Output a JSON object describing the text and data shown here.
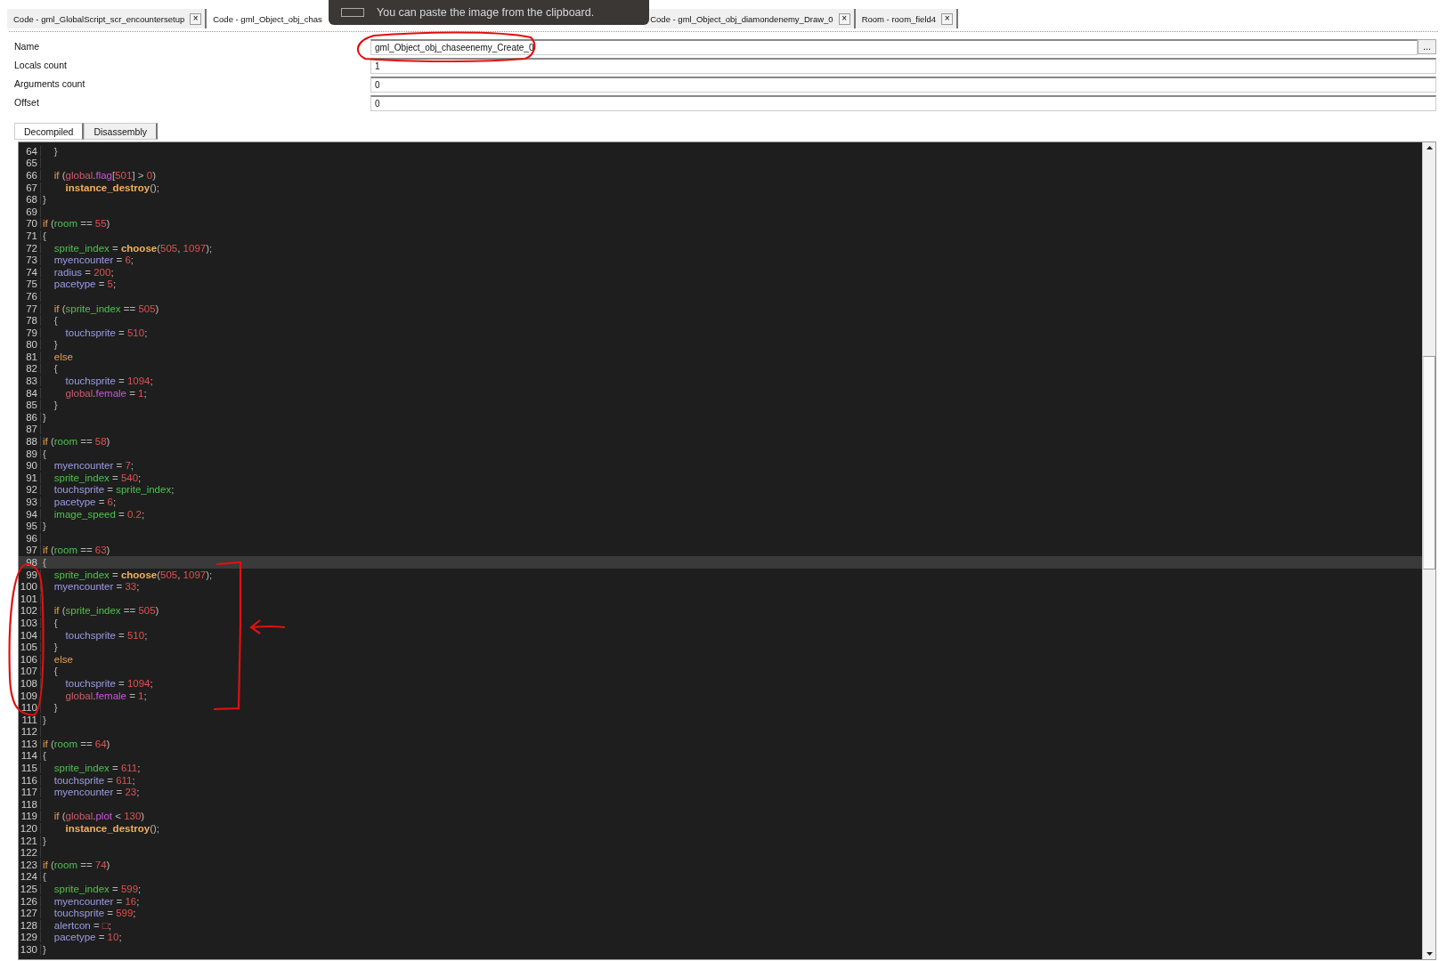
{
  "tabs": [
    {
      "label": "Code - gml_GlobalScript_scr_encountersetup",
      "close": "×",
      "selected": false
    },
    {
      "label": "Code - gml_Object_obj_chas",
      "selected": true
    },
    {
      "label": "Code - gml_Object_obj_diamondenemy_Draw_0",
      "close": "×",
      "selected": false
    },
    {
      "label": "Room - room_field4",
      "close": "×",
      "selected": false
    }
  ],
  "toast": {
    "text": "You can paste the image from the clipboard."
  },
  "fields": [
    {
      "label": "Name",
      "value": "gml_Object_obj_chaseenemy_Create_0",
      "button": "..."
    },
    {
      "label": "Locals count",
      "value": "1"
    },
    {
      "label": "Arguments count",
      "value": "0"
    },
    {
      "label": "Offset",
      "value": "0"
    }
  ],
  "view_tabs": [
    {
      "label": "Decompiled",
      "selected": true
    },
    {
      "label": "Disassembly",
      "selected": false
    }
  ],
  "code_lines": [
    {
      "number": "64",
      "selected": false,
      "tokens": [
        {
          "kind": "punct",
          "text": "    }"
        }
      ]
    },
    {
      "number": "65",
      "selected": false
    },
    {
      "number": "66",
      "selected": false,
      "tokens": [
        {
          "kind": "keyword",
          "text": "    if"
        },
        {
          "kind": "punct",
          "text": " ("
        },
        {
          "kind": "global",
          "text": "global"
        },
        {
          "kind": "punct",
          "text": "."
        },
        {
          "kind": "member",
          "text": "flag"
        },
        {
          "kind": "punct",
          "text": "["
        },
        {
          "kind": "number",
          "text": "501"
        },
        {
          "kind": "punct",
          "text": "] > "
        },
        {
          "kind": "number",
          "text": "0"
        },
        {
          "kind": "punct",
          "text": ")"
        }
      ]
    },
    {
      "number": "67",
      "selected": false,
      "tokens": [
        {
          "kind": "function",
          "text": "        instance_destroy"
        },
        {
          "kind": "punct",
          "text": "();"
        }
      ]
    },
    {
      "number": "68",
      "selected": false,
      "tokens": [
        {
          "kind": "punct",
          "text": "}"
        }
      ]
    },
    {
      "number": "69",
      "selected": false
    },
    {
      "number": "70",
      "selected": false,
      "tokens": [
        {
          "kind": "keyword",
          "text": "if"
        },
        {
          "kind": "punct",
          "text": " ("
        },
        {
          "kind": "builtin",
          "text": "room"
        },
        {
          "kind": "punct",
          "text": " == "
        },
        {
          "kind": "number",
          "text": "55"
        },
        {
          "kind": "punct",
          "text": ")"
        }
      ]
    },
    {
      "number": "71",
      "selected": false,
      "tokens": [
        {
          "kind": "punct",
          "text": "{"
        }
      ]
    },
    {
      "number": "72",
      "selected": false,
      "tokens": [
        {
          "kind": "builtin",
          "text": "    sprite_index"
        },
        {
          "kind": "punct",
          "text": " = "
        },
        {
          "kind": "function",
          "text": "choose"
        },
        {
          "kind": "punct",
          "text": "("
        },
        {
          "kind": "number",
          "text": "505"
        },
        {
          "kind": "punct",
          "text": ", "
        },
        {
          "kind": "number",
          "text": "1097"
        },
        {
          "kind": "punct",
          "text": ");"
        }
      ]
    },
    {
      "number": "73",
      "selected": false,
      "tokens": [
        {
          "kind": "variable",
          "text": "    myencounter"
        },
        {
          "kind": "punct",
          "text": " = "
        },
        {
          "kind": "number",
          "text": "6"
        },
        {
          "kind": "punct",
          "text": ";"
        }
      ]
    },
    {
      "number": "74",
      "selected": false,
      "tokens": [
        {
          "kind": "variable",
          "text": "    radius"
        },
        {
          "kind": "punct",
          "text": " = "
        },
        {
          "kind": "number",
          "text": "200"
        },
        {
          "kind": "punct",
          "text": ";"
        }
      ]
    },
    {
      "number": "75",
      "selected": false,
      "tokens": [
        {
          "kind": "variable",
          "text": "    pacetype"
        },
        {
          "kind": "punct",
          "text": " = "
        },
        {
          "kind": "number",
          "text": "5"
        },
        {
          "kind": "punct",
          "text": ";"
        }
      ]
    },
    {
      "number": "76",
      "selected": false
    },
    {
      "number": "77",
      "selected": false,
      "tokens": [
        {
          "kind": "keyword",
          "text": "    if"
        },
        {
          "kind": "punct",
          "text": " ("
        },
        {
          "kind": "builtin",
          "text": "sprite_index"
        },
        {
          "kind": "punct",
          "text": " == "
        },
        {
          "kind": "number",
          "text": "505"
        },
        {
          "kind": "punct",
          "text": ")"
        }
      ]
    },
    {
      "number": "78",
      "selected": false,
      "tokens": [
        {
          "kind": "punct",
          "text": "    {"
        }
      ]
    },
    {
      "number": "79",
      "selected": false,
      "tokens": [
        {
          "kind": "variable",
          "text": "        touchsprite"
        },
        {
          "kind": "punct",
          "text": " = "
        },
        {
          "kind": "number",
          "text": "510"
        },
        {
          "kind": "punct",
          "text": ";"
        }
      ]
    },
    {
      "number": "80",
      "selected": false,
      "tokens": [
        {
          "kind": "punct",
          "text": "    }"
        }
      ]
    },
    {
      "number": "81",
      "selected": false,
      "tokens": [
        {
          "kind": "keyword",
          "text": "    else"
        }
      ]
    },
    {
      "number": "82",
      "selected": false,
      "tokens": [
        {
          "kind": "punct",
          "text": "    {"
        }
      ]
    },
    {
      "number": "83",
      "selected": false,
      "tokens": [
        {
          "kind": "variable",
          "text": "        touchsprite"
        },
        {
          "kind": "punct",
          "text": " = "
        },
        {
          "kind": "number",
          "text": "1094"
        },
        {
          "kind": "punct",
          "text": ";"
        }
      ]
    },
    {
      "number": "84",
      "selected": false,
      "tokens": [
        {
          "kind": "global",
          "text": "        global"
        },
        {
          "kind": "punct",
          "text": "."
        },
        {
          "kind": "member",
          "text": "female"
        },
        {
          "kind": "punct",
          "text": " = "
        },
        {
          "kind": "number",
          "text": "1"
        },
        {
          "kind": "punct",
          "text": ";"
        }
      ]
    },
    {
      "number": "85",
      "selected": false,
      "tokens": [
        {
          "kind": "punct",
          "text": "    }"
        }
      ]
    },
    {
      "number": "86",
      "selected": false,
      "tokens": [
        {
          "kind": "punct",
          "text": "}"
        }
      ]
    },
    {
      "number": "87",
      "selected": false
    },
    {
      "number": "88",
      "selected": false,
      "tokens": [
        {
          "kind": "keyword",
          "text": "if"
        },
        {
          "kind": "punct",
          "text": " ("
        },
        {
          "kind": "builtin",
          "text": "room"
        },
        {
          "kind": "punct",
          "text": " == "
        },
        {
          "kind": "number",
          "text": "58"
        },
        {
          "kind": "punct",
          "text": ")"
        }
      ]
    },
    {
      "number": "89",
      "selected": false,
      "tokens": [
        {
          "kind": "punct",
          "text": "{"
        }
      ]
    },
    {
      "number": "90",
      "selected": false,
      "tokens": [
        {
          "kind": "variable",
          "text": "    myencounter"
        },
        {
          "kind": "punct",
          "text": " = "
        },
        {
          "kind": "number",
          "text": "7"
        },
        {
          "kind": "punct",
          "text": ";"
        }
      ]
    },
    {
      "number": "91",
      "selected": false,
      "tokens": [
        {
          "kind": "builtin",
          "text": "    sprite_index"
        },
        {
          "kind": "punct",
          "text": " = "
        },
        {
          "kind": "number",
          "text": "540"
        },
        {
          "kind": "punct",
          "text": ";"
        }
      ]
    },
    {
      "number": "92",
      "selected": false,
      "tokens": [
        {
          "kind": "variable",
          "text": "    touchsprite"
        },
        {
          "kind": "punct",
          "text": " = "
        },
        {
          "kind": "builtin",
          "text": "sprite_index"
        },
        {
          "kind": "punct",
          "text": ";"
        }
      ]
    },
    {
      "number": "93",
      "selected": false,
      "tokens": [
        {
          "kind": "variable",
          "text": "    pacetype"
        },
        {
          "kind": "punct",
          "text": " = "
        },
        {
          "kind": "number",
          "text": "6"
        },
        {
          "kind": "punct",
          "text": ";"
        }
      ]
    },
    {
      "number": "94",
      "selected": false,
      "tokens": [
        {
          "kind": "builtin",
          "text": "    image_speed"
        },
        {
          "kind": "punct",
          "text": " = "
        },
        {
          "kind": "number",
          "text": "0.2"
        },
        {
          "kind": "punct",
          "text": ";"
        }
      ]
    },
    {
      "number": "95",
      "selected": false,
      "tokens": [
        {
          "kind": "punct",
          "text": "}"
        }
      ]
    },
    {
      "number": "96",
      "selected": false
    },
    {
      "number": "97",
      "selected": false,
      "tokens": [
        {
          "kind": "keyword",
          "text": "if"
        },
        {
          "kind": "punct",
          "text": " ("
        },
        {
          "kind": "builtin",
          "text": "room"
        },
        {
          "kind": "punct",
          "text": " == "
        },
        {
          "kind": "number",
          "text": "63"
        },
        {
          "kind": "punct",
          "text": ")"
        }
      ]
    },
    {
      "number": "98",
      "selected": true,
      "tokens": [
        {
          "kind": "punct",
          "text": "{"
        }
      ]
    },
    {
      "number": "99",
      "selected": false,
      "tokens": [
        {
          "kind": "builtin",
          "text": "    sprite_index"
        },
        {
          "kind": "punct",
          "text": " = "
        },
        {
          "kind": "function",
          "text": "choose"
        },
        {
          "kind": "punct",
          "text": "("
        },
        {
          "kind": "number",
          "text": "505"
        },
        {
          "kind": "punct",
          "text": ", "
        },
        {
          "kind": "number",
          "text": "1097"
        },
        {
          "kind": "punct",
          "text": ");"
        }
      ]
    },
    {
      "number": "100",
      "selected": false,
      "tokens": [
        {
          "kind": "variable",
          "text": "    myencounter"
        },
        {
          "kind": "punct",
          "text": " = "
        },
        {
          "kind": "number",
          "text": "33"
        },
        {
          "kind": "punct",
          "text": ";"
        }
      ]
    },
    {
      "number": "101",
      "selected": false
    },
    {
      "number": "102",
      "selected": false,
      "tokens": [
        {
          "kind": "keyword",
          "text": "    if"
        },
        {
          "kind": "punct",
          "text": " ("
        },
        {
          "kind": "builtin",
          "text": "sprite_index"
        },
        {
          "kind": "punct",
          "text": " == "
        },
        {
          "kind": "number",
          "text": "505"
        },
        {
          "kind": "punct",
          "text": ")"
        }
      ]
    },
    {
      "number": "103",
      "selected": false,
      "tokens": [
        {
          "kind": "punct",
          "text": "    {"
        }
      ]
    },
    {
      "number": "104",
      "selected": false,
      "tokens": [
        {
          "kind": "variable",
          "text": "        touchsprite"
        },
        {
          "kind": "punct",
          "text": " = "
        },
        {
          "kind": "number",
          "text": "510"
        },
        {
          "kind": "punct",
          "text": ";"
        }
      ]
    },
    {
      "number": "105",
      "selected": false,
      "tokens": [
        {
          "kind": "punct",
          "text": "    }"
        }
      ]
    },
    {
      "number": "106",
      "selected": false,
      "tokens": [
        {
          "kind": "keyword",
          "text": "    else"
        }
      ]
    },
    {
      "number": "107",
      "selected": false,
      "tokens": [
        {
          "kind": "punct",
          "text": "    {"
        }
      ]
    },
    {
      "number": "108",
      "selected": false,
      "tokens": [
        {
          "kind": "variable",
          "text": "        touchsprite"
        },
        {
          "kind": "punct",
          "text": " = "
        },
        {
          "kind": "number",
          "text": "1094"
        },
        {
          "kind": "punct",
          "text": ";"
        }
      ]
    },
    {
      "number": "109",
      "selected": false,
      "tokens": [
        {
          "kind": "global",
          "text": "        global"
        },
        {
          "kind": "punct",
          "text": "."
        },
        {
          "kind": "member",
          "text": "female"
        },
        {
          "kind": "punct",
          "text": " = "
        },
        {
          "kind": "number",
          "text": "1"
        },
        {
          "kind": "punct",
          "text": ";"
        }
      ]
    },
    {
      "number": "110",
      "selected": false,
      "tokens": [
        {
          "kind": "punct",
          "text": "    }"
        }
      ]
    },
    {
      "number": "111",
      "selected": false,
      "tokens": [
        {
          "kind": "punct",
          "text": "}"
        }
      ]
    },
    {
      "number": "112",
      "selected": false
    },
    {
      "number": "113",
      "selected": false,
      "tokens": [
        {
          "kind": "keyword",
          "text": "if"
        },
        {
          "kind": "punct",
          "text": " ("
        },
        {
          "kind": "builtin",
          "text": "room"
        },
        {
          "kind": "punct",
          "text": " == "
        },
        {
          "kind": "number",
          "text": "64"
        },
        {
          "kind": "punct",
          "text": ")"
        }
      ]
    },
    {
      "number": "114",
      "selected": false,
      "tokens": [
        {
          "kind": "punct",
          "text": "{"
        }
      ]
    },
    {
      "number": "115",
      "selected": false,
      "tokens": [
        {
          "kind": "builtin",
          "text": "    sprite_index"
        },
        {
          "kind": "punct",
          "text": " = "
        },
        {
          "kind": "number",
          "text": "611"
        },
        {
          "kind": "punct",
          "text": ";"
        }
      ]
    },
    {
      "number": "116",
      "selected": false,
      "tokens": [
        {
          "kind": "variable",
          "text": "    touchsprite"
        },
        {
          "kind": "punct",
          "text": " = "
        },
        {
          "kind": "number",
          "text": "611"
        },
        {
          "kind": "punct",
          "text": ";"
        }
      ]
    },
    {
      "number": "117",
      "selected": false,
      "tokens": [
        {
          "kind": "variable",
          "text": "    myencounter"
        },
        {
          "kind": "punct",
          "text": " = "
        },
        {
          "kind": "number",
          "text": "23"
        },
        {
          "kind": "punct",
          "text": ";"
        }
      ]
    },
    {
      "number": "118",
      "selected": false
    },
    {
      "number": "119",
      "selected": false,
      "tokens": [
        {
          "kind": "keyword",
          "text": "    if"
        },
        {
          "kind": "punct",
          "text": " ("
        },
        {
          "kind": "global",
          "text": "global"
        },
        {
          "kind": "punct",
          "text": "."
        },
        {
          "kind": "member",
          "text": "plot"
        },
        {
          "kind": "punct",
          "text": " < "
        },
        {
          "kind": "number",
          "text": "130"
        },
        {
          "kind": "punct",
          "text": ")"
        }
      ]
    },
    {
      "number": "120",
      "selected": false,
      "tokens": [
        {
          "kind": "function",
          "text": "        instance_destroy"
        },
        {
          "kind": "punct",
          "text": "();"
        }
      ]
    },
    {
      "number": "121",
      "selected": false,
      "tokens": [
        {
          "kind": "punct",
          "text": "}"
        }
      ]
    },
    {
      "number": "122",
      "selected": false
    },
    {
      "number": "123",
      "selected": false,
      "tokens": [
        {
          "kind": "keyword",
          "text": "if"
        },
        {
          "kind": "punct",
          "text": " ("
        },
        {
          "kind": "builtin",
          "text": "room"
        },
        {
          "kind": "punct",
          "text": " == "
        },
        {
          "kind": "number",
          "text": "74"
        },
        {
          "kind": "punct",
          "text": ")"
        }
      ]
    },
    {
      "number": "124",
      "selected": false,
      "tokens": [
        {
          "kind": "punct",
          "text": "{"
        }
      ]
    },
    {
      "number": "125",
      "selected": false,
      "tokens": [
        {
          "kind": "builtin",
          "text": "    sprite_index"
        },
        {
          "kind": "punct",
          "text": " = "
        },
        {
          "kind": "number",
          "text": "599"
        },
        {
          "kind": "punct",
          "text": ";"
        }
      ]
    },
    {
      "number": "126",
      "selected": false,
      "tokens": [
        {
          "kind": "variable",
          "text": "    myencounter"
        },
        {
          "kind": "punct",
          "text": " = "
        },
        {
          "kind": "number",
          "text": "16"
        },
        {
          "kind": "punct",
          "text": ";"
        }
      ]
    },
    {
      "number": "127",
      "selected": false,
      "tokens": [
        {
          "kind": "variable",
          "text": "    touchsprite"
        },
        {
          "kind": "punct",
          "text": " = "
        },
        {
          "kind": "number",
          "text": "599"
        },
        {
          "kind": "punct",
          "text": ";"
        }
      ]
    },
    {
      "number": "128",
      "selected": false,
      "tokens": [
        {
          "kind": "variable",
          "text": "    alertcon"
        },
        {
          "kind": "punct",
          "text": " = "
        },
        {
          "kind": "number",
          "text": "□"
        },
        {
          "kind": "punct",
          "text": ";"
        }
      ]
    },
    {
      "number": "129",
      "selected": false,
      "tokens": [
        {
          "kind": "variable",
          "text": "    pacetype"
        },
        {
          "kind": "punct",
          "text": " = "
        },
        {
          "kind": "number",
          "text": "10"
        },
        {
          "kind": "punct",
          "text": ";"
        }
      ]
    },
    {
      "number": "130",
      "selected": false,
      "tokens": [
        {
          "kind": "punct",
          "text": "}"
        }
      ]
    }
  ]
}
